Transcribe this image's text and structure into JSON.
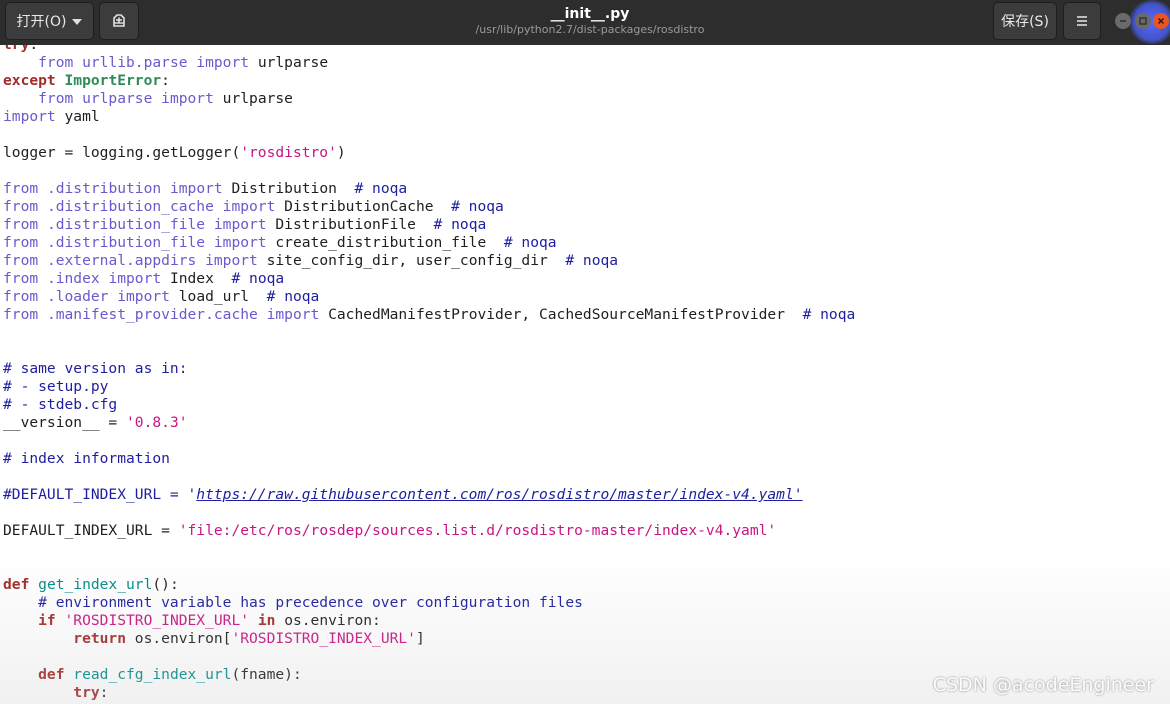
{
  "header": {
    "open_label": "打开(O)",
    "save_label": "保存(S)",
    "title": "__init__.py",
    "subtitle": "/usr/lib/python2.7/dist-packages/rosdistro",
    "icons": {
      "open_dropdown": "chevron-down-icon",
      "new_document": "new-document-icon",
      "menu": "hamburger-menu-icon",
      "minimize": "minimize-icon",
      "maximize": "maximize-icon",
      "close": "close-icon"
    },
    "colors": {
      "bar": "#2d2d2d",
      "close": "#e95420"
    }
  },
  "editor": {
    "lines": [
      [
        {
          "t": "try",
          "c": "kw"
        },
        {
          "t": ":",
          "c": ""
        }
      ],
      [
        {
          "t": "    from ",
          "c": "kw2"
        },
        {
          "t": "urllib.parse",
          "c": "mod"
        },
        {
          "t": " import ",
          "c": "kw2"
        },
        {
          "t": "urlparse",
          "c": ""
        }
      ],
      [
        {
          "t": "except ",
          "c": "kw"
        },
        {
          "t": "ImportError",
          "c": "ex"
        },
        {
          "t": ":",
          "c": ""
        }
      ],
      [
        {
          "t": "    from ",
          "c": "kw2"
        },
        {
          "t": "urlparse",
          "c": "mod"
        },
        {
          "t": " import ",
          "c": "kw2"
        },
        {
          "t": "urlparse",
          "c": ""
        }
      ],
      [
        {
          "t": "import ",
          "c": "kw2"
        },
        {
          "t": "yaml",
          "c": ""
        }
      ],
      [],
      [
        {
          "t": "logger = logging.getLogger(",
          "c": ""
        },
        {
          "t": "'rosdistro'",
          "c": "str"
        },
        {
          "t": ")",
          "c": ""
        }
      ],
      [],
      [
        {
          "t": "from ",
          "c": "kw2"
        },
        {
          "t": ".distribution",
          "c": "mod"
        },
        {
          "t": " import ",
          "c": "kw2"
        },
        {
          "t": "Distribution  ",
          "c": ""
        },
        {
          "t": "# noqa",
          "c": "cm"
        }
      ],
      [
        {
          "t": "from ",
          "c": "kw2"
        },
        {
          "t": ".distribution_cache",
          "c": "mod"
        },
        {
          "t": " import ",
          "c": "kw2"
        },
        {
          "t": "DistributionCache  ",
          "c": ""
        },
        {
          "t": "# noqa",
          "c": "cm"
        }
      ],
      [
        {
          "t": "from ",
          "c": "kw2"
        },
        {
          "t": ".distribution_file",
          "c": "mod"
        },
        {
          "t": " import ",
          "c": "kw2"
        },
        {
          "t": "DistributionFile  ",
          "c": ""
        },
        {
          "t": "# noqa",
          "c": "cm"
        }
      ],
      [
        {
          "t": "from ",
          "c": "kw2"
        },
        {
          "t": ".distribution_file",
          "c": "mod"
        },
        {
          "t": " import ",
          "c": "kw2"
        },
        {
          "t": "create_distribution_file  ",
          "c": ""
        },
        {
          "t": "# noqa",
          "c": "cm"
        }
      ],
      [
        {
          "t": "from ",
          "c": "kw2"
        },
        {
          "t": ".external.appdirs",
          "c": "mod"
        },
        {
          "t": " import ",
          "c": "kw2"
        },
        {
          "t": "site_config_dir, user_config_dir  ",
          "c": ""
        },
        {
          "t": "# noqa",
          "c": "cm"
        }
      ],
      [
        {
          "t": "from ",
          "c": "kw2"
        },
        {
          "t": ".index",
          "c": "mod"
        },
        {
          "t": " import ",
          "c": "kw2"
        },
        {
          "t": "Index  ",
          "c": ""
        },
        {
          "t": "# noqa",
          "c": "cm"
        }
      ],
      [
        {
          "t": "from ",
          "c": "kw2"
        },
        {
          "t": ".loader",
          "c": "mod"
        },
        {
          "t": " import ",
          "c": "kw2"
        },
        {
          "t": "load_url  ",
          "c": ""
        },
        {
          "t": "# noqa",
          "c": "cm"
        }
      ],
      [
        {
          "t": "from ",
          "c": "kw2"
        },
        {
          "t": ".manifest_provider.cache",
          "c": "mod"
        },
        {
          "t": " import ",
          "c": "kw2"
        },
        {
          "t": "CachedManifestProvider, CachedSourceManifestProvider  ",
          "c": ""
        },
        {
          "t": "# noqa",
          "c": "cm"
        }
      ],
      [],
      [],
      [
        {
          "t": "# same version as in:",
          "c": "cm"
        }
      ],
      [
        {
          "t": "# - setup.py",
          "c": "cm"
        }
      ],
      [
        {
          "t": "# - stdeb.cfg",
          "c": "cm"
        }
      ],
      [
        {
          "t": "__version__ = ",
          "c": ""
        },
        {
          "t": "'0.8.3'",
          "c": "str"
        }
      ],
      [],
      [
        {
          "t": "# index information",
          "c": "cm"
        }
      ],
      [],
      [
        {
          "t": "#DEFAULT_INDEX_URL = '",
          "c": "cm"
        },
        {
          "t": "https://raw.githubusercontent.com/ros/rosdistro/master/index-v4.yaml'",
          "c": "url"
        }
      ],
      [],
      [
        {
          "t": "DEFAULT_INDEX_URL = ",
          "c": ""
        },
        {
          "t": "'file:/etc/ros/rosdep/sources.list.d/rosdistro-master/index-v4.yaml'",
          "c": "str"
        }
      ],
      [],
      [],
      [
        {
          "t": "def ",
          "c": "kw"
        },
        {
          "t": "get_index_url",
          "c": "fn"
        },
        {
          "t": "():",
          "c": ""
        }
      ],
      [
        {
          "t": "    # environment variable has precedence over configuration files",
          "c": "cm"
        }
      ],
      [
        {
          "t": "    if ",
          "c": "kw"
        },
        {
          "t": "'ROSDISTRO_INDEX_URL'",
          "c": "str"
        },
        {
          "t": " in ",
          "c": "kw"
        },
        {
          "t": "os.environ:",
          "c": ""
        }
      ],
      [
        {
          "t": "        return ",
          "c": "kw"
        },
        {
          "t": "os.environ[",
          "c": ""
        },
        {
          "t": "'ROSDISTRO_INDEX_URL'",
          "c": "str"
        },
        {
          "t": "]",
          "c": ""
        }
      ],
      [],
      [
        {
          "t": "    def ",
          "c": "kw"
        },
        {
          "t": "read_cfg_index_url",
          "c": "fn"
        },
        {
          "t": "(fname):",
          "c": ""
        }
      ],
      [
        {
          "t": "        try",
          "c": "kw"
        },
        {
          "t": ":",
          "c": ""
        }
      ]
    ]
  },
  "watermark": "CSDN @acodeEngineer"
}
